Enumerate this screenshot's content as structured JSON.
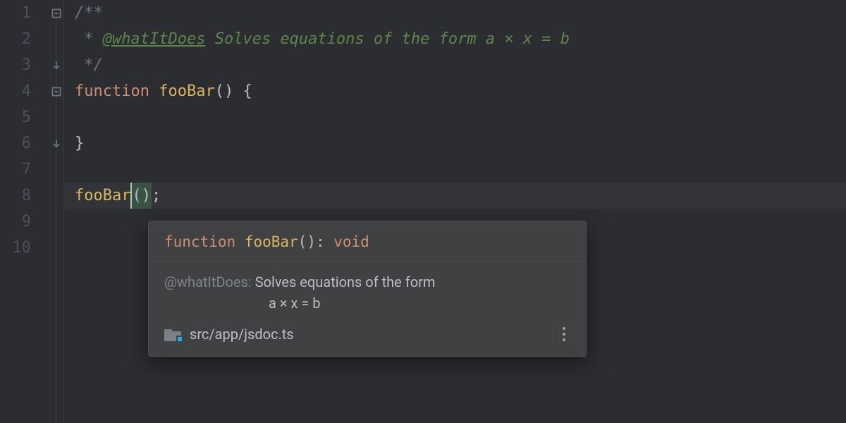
{
  "gutter": {
    "numbers": [
      "1",
      "2",
      "3",
      "4",
      "5",
      "6",
      "7",
      "8",
      "9",
      "10"
    ]
  },
  "code": {
    "doc_open": "/**",
    "doc_prefix": " * ",
    "doc_tag": "@whatItDoes",
    "doc_text": " Solves equations of the form a × x = b",
    "doc_close": " */",
    "fn_kw": "function",
    "fn_name": "fooBar",
    "fn_parens_open": "() {",
    "fn_close": "}",
    "call_name": "fooBar",
    "call_parens": "()",
    "call_semi": ";"
  },
  "tooltip": {
    "sig_kw": "function",
    "sig_name": "fooBar",
    "sig_after": "(): ",
    "sig_ret": "void",
    "doc_tag": "@whatItDoes:",
    "doc_line1": "Solves equations of the form",
    "doc_line2": "a × x = b",
    "src_path": "src/app/jsdoc.ts"
  }
}
